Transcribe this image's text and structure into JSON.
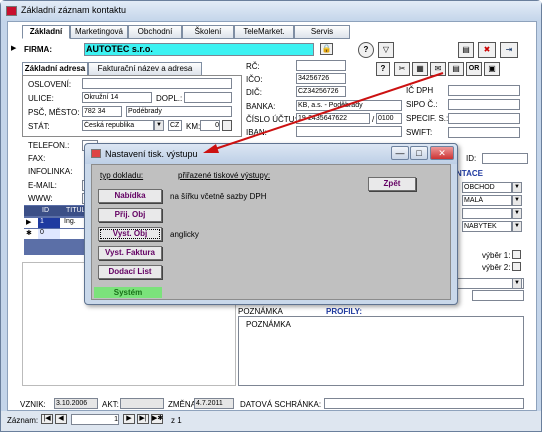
{
  "window": {
    "title": "Základní záznam kontaktu",
    "btn_min": "—",
    "btn_max": "□",
    "btn_close": "✕"
  },
  "tabs": [
    "Základní",
    "Marketingová",
    "Obchodní",
    "Školení",
    "TeleMarket.",
    "Servis"
  ],
  "firma": {
    "label": "FIRMA:",
    "value": "AUTOTEC s.r.o.",
    "lock_icon": "lock-icon"
  },
  "address_tabs": {
    "tab1": "Základní adresa",
    "tab2": "Fakturační název a adresa"
  },
  "address": {
    "osloveni_label": "OSLOVENÍ:",
    "osloveni": "",
    "ulice_label": "ULICE:",
    "ulice": "Okružní 14",
    "dopl_label": "DOPL.:",
    "dopl": "",
    "psc_label": "PSČ, MĚSTO:",
    "psc": "782 34",
    "mesto": "Podébrady",
    "stat_label": "STÁT:",
    "stat": "Česká republika",
    "stat_code": "CZ",
    "km_label": "KM:",
    "km": "0"
  },
  "ids": {
    "rc_label": "RČ:",
    "rc": "",
    "ico_label": "IČO:",
    "ico": "34256726",
    "dic_label": "DIČ:",
    "dic": "CZ34256726",
    "banka_label": "BANKA:",
    "banka": "KB, a.s. - Poděbrady",
    "cislo_label": "ČÍSLO ÚČTU:",
    "cislo": "19-2435647622",
    "bank_code": "0100",
    "iban_label": "IBAN:",
    "iban": "",
    "icdph_label": "IČ DPH",
    "sipo_label": "SIPO Č.:",
    "specif_label": "SPECIF. S.:",
    "swift_label": "SWIFT:",
    "id_label": "ID:"
  },
  "contact": {
    "telefon_label": "TELEFON.:",
    "fax_label": "FAX:",
    "infolinka_label": "INFOLINKA:",
    "email_label": "E-MAIL:",
    "www_label": "WWW:",
    "email_partial": "te",
    "www_partial": "w"
  },
  "grid": {
    "headers": [
      "ID",
      "TITUL"
    ],
    "rows": [
      [
        "1",
        "Ing."
      ],
      [
        "0",
        ""
      ]
    ]
  },
  "right": {
    "kontakt_label": "NTACE",
    "sel1": "OBCHOD",
    "sel2": "MALÁ",
    "sel3": "NABYTEK",
    "vyber1": "výběr 1:",
    "vyber2": "výběr 2:"
  },
  "notes": {
    "poznamka_label": "POZNÁMKA",
    "profily_label": "PROFILY:",
    "poznamka2_label": "POZNÁMKA",
    "datova_label": "DATOVÁ SCHRÁNKA:",
    "datova": ""
  },
  "footer": {
    "vznik_label": "VZNIK:",
    "vznik": "3.10.2006",
    "akt_label": "AKT:",
    "zmena_label": "ZMĚNA:",
    "zmena": "4.7.2011"
  },
  "status": {
    "zaznam_label": "Záznam:",
    "record": "1",
    "of": "z 1"
  },
  "dialog": {
    "title": "Nastavení tisk. výstupu",
    "col1": "typ dokladu:",
    "col2": "přiřazené tiskové výstupy:",
    "btn_back": "Zpět",
    "items": [
      "Nabídka",
      "Přij. Obj",
      "Vyst. Obj",
      "Vyst. Faktura",
      "Dodací List"
    ],
    "desc1": "na šířku včetně sazby DPH",
    "desc3": "anglicky",
    "system": "Systém"
  },
  "colors": {
    "highlight": "#3cf2f2",
    "button_text": "#630063",
    "arrow": "#cc1111",
    "grid": "#5b6fa7"
  }
}
